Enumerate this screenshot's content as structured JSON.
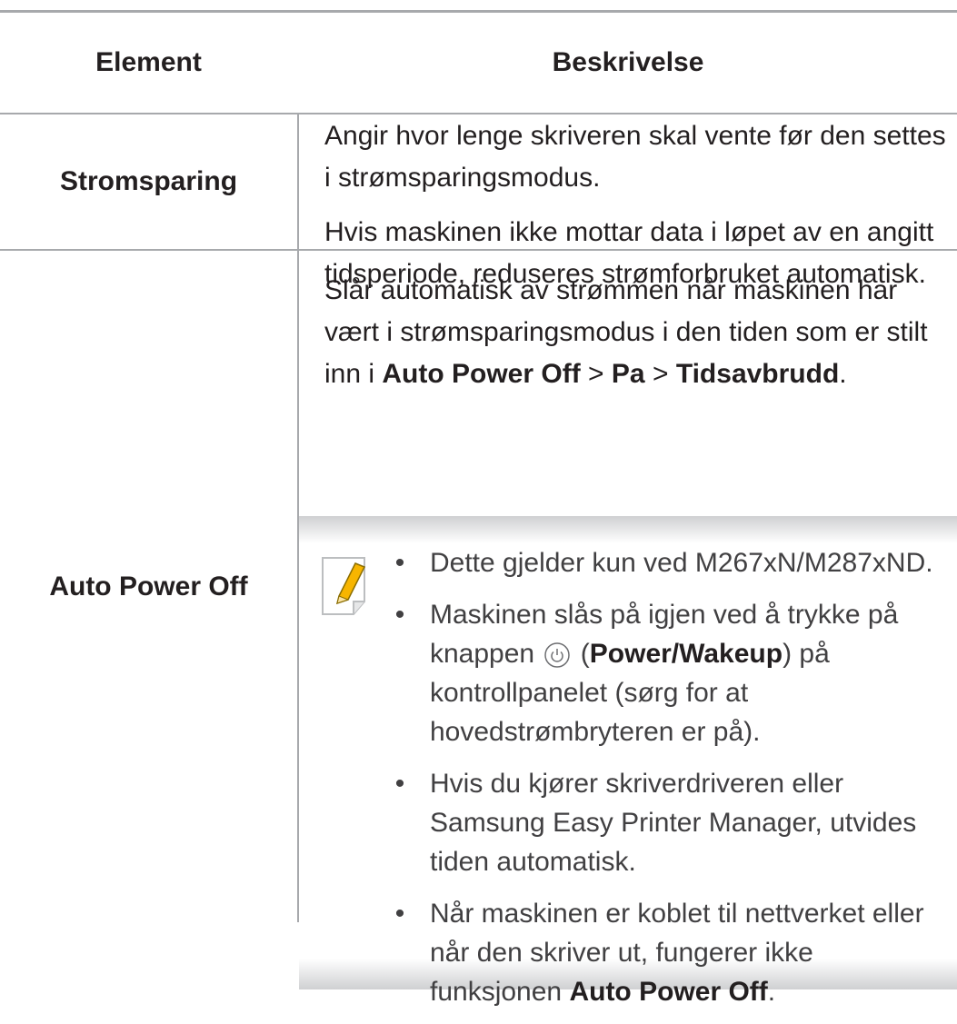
{
  "table": {
    "headers": {
      "element": "Element",
      "description": "Beskrivelse"
    },
    "rows": [
      {
        "element": "Stromsparing",
        "paragraphs": [
          "Angir hvor lenge skriveren skal vente før den settes i strømsparingsmodus.",
          "Hvis maskinen ikke mottar data i løpet av en angitt tidsperiode, reduseres strømforbruket automatisk."
        ]
      },
      {
        "element": "Auto Power Off",
        "intro": {
          "text": "Slår automatisk av strømmen når maskinen har vært i strømsparingsmodus i den tiden som er stilt inn i ",
          "path_1": "Auto Power Off",
          "sep_1": " > ",
          "path_2": "Pa",
          "sep_2": " > ",
          "path_3": "Tidsavbrudd",
          "end": "."
        },
        "note": {
          "icon": "note-pencil-icon",
          "bullet": "•",
          "items": [
            {
              "text": "Dette gjelder kun ved M267xN/M287xND."
            },
            {
              "text_a": "Maskinen slås på igjen ved å trykke på knappen ",
              "icon": "power-icon",
              "text_b": " (",
              "bold": "Power/Wakeup",
              "text_c": ") på kontrollpanelet (sørg for at hovedstrømbryteren er på)."
            },
            {
              "text": "Hvis du kjører skriverdriveren eller Samsung Easy Printer Manager, utvides tiden automatisk."
            },
            {
              "text_a": "Når maskinen er koblet til nettverket eller når den skriver ut, fungerer ikke funksjonen ",
              "bold": "Auto Power Off",
              "text_c": "."
            }
          ]
        }
      }
    ]
  },
  "colors": {
    "rule": "#a7a9ac",
    "text": "#231f20",
    "note_text": "#414042",
    "note_icon_accent": "#f7b500"
  }
}
